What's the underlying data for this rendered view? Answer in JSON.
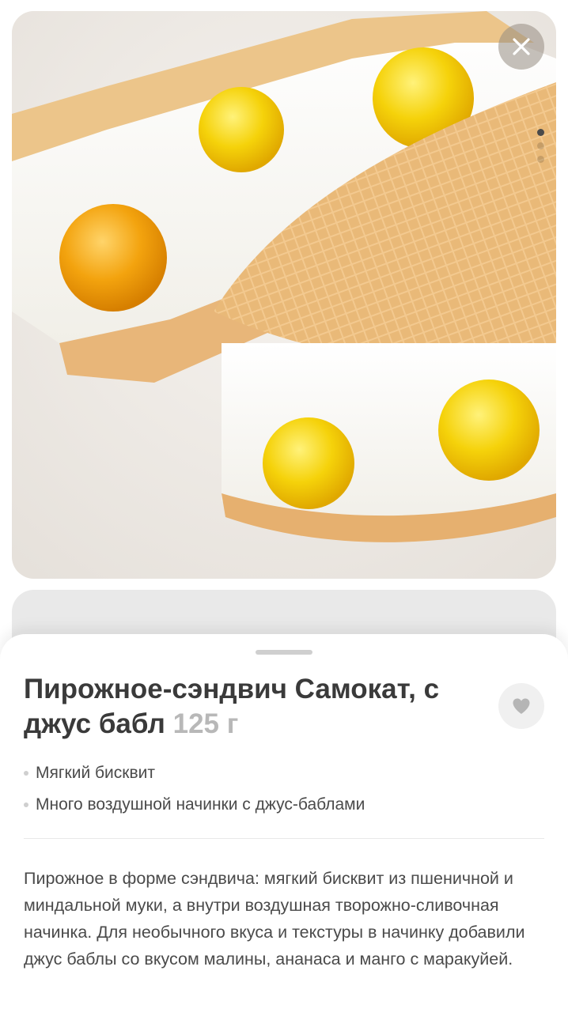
{
  "product": {
    "title": "Пирожное-сэндвич Самокат, с джус бабл",
    "weight": "125 г",
    "features": [
      "Мягкий бисквит",
      "Много воздушной начинки с джус-баблами"
    ],
    "description": "Пирожное в форме сэндвича: мягкий бисквит из пшеничной и миндальной муки, а внутри воздушная творожно-сливочная начинка. Для необычного вкуса и текстуры в начинку добавили джус баблы со вкусом малины, ананаса и манго с маракуйей."
  },
  "gallery": {
    "pages": 3,
    "active_page": 1
  },
  "icons": {
    "close": "close-icon",
    "favorite": "heart-icon"
  },
  "colors": {
    "title": "#3a3a3a",
    "weight": "#b8b8b8",
    "text": "#4a4a4a",
    "divider": "#e8e8e8"
  }
}
